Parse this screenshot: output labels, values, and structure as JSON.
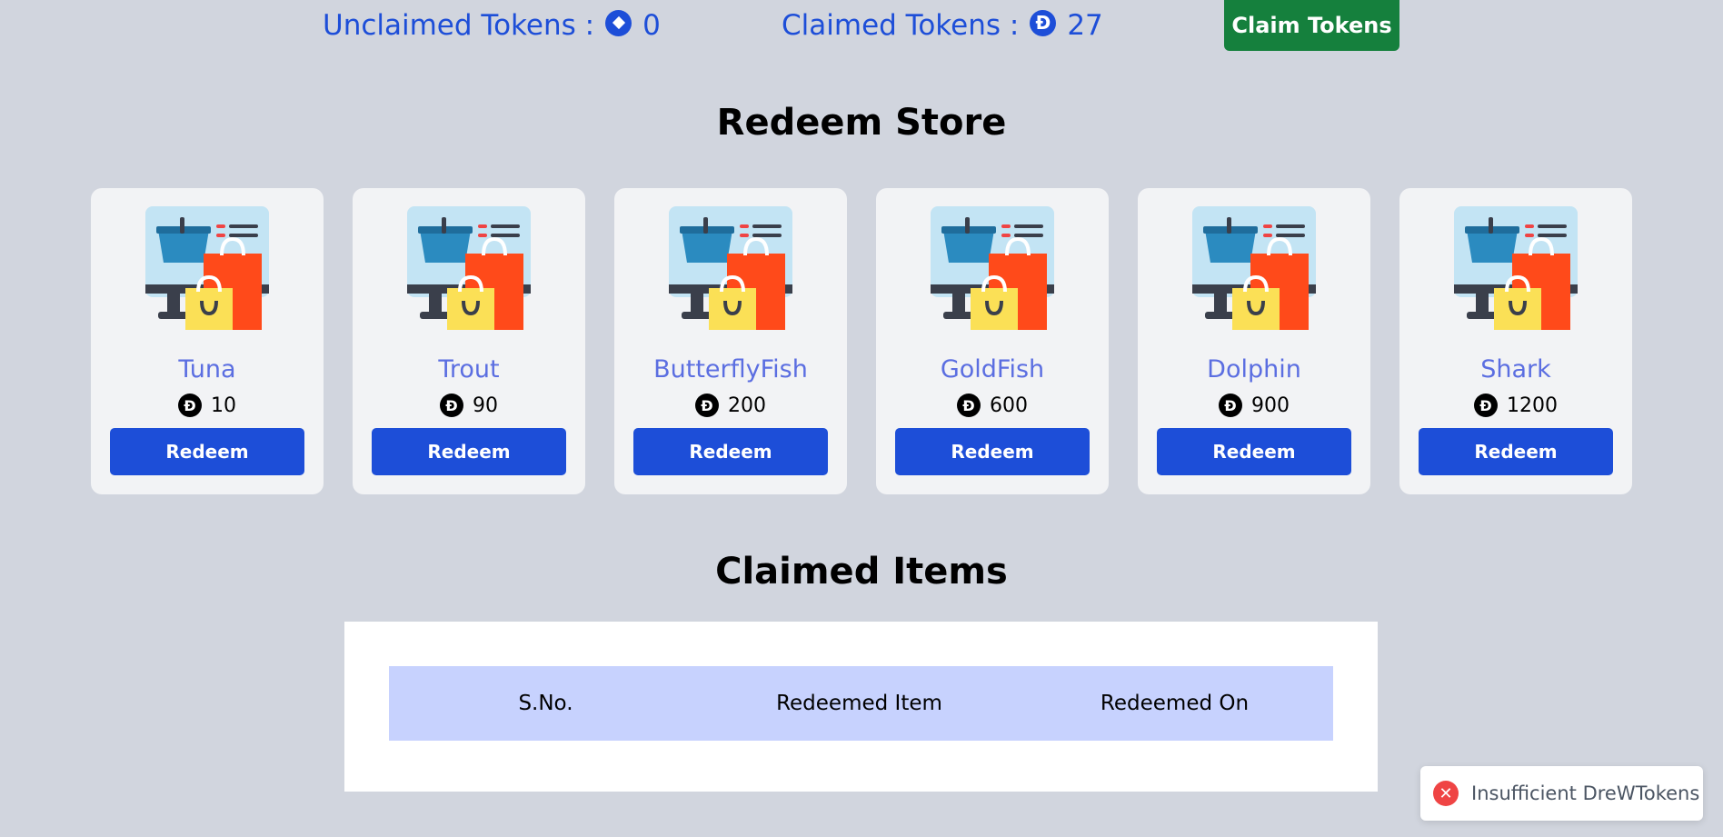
{
  "tokens": {
    "unclaimed_label": "Unclaimed Tokens :",
    "unclaimed_value": "0",
    "claimed_label": "Claimed Tokens :",
    "claimed_value": "27",
    "claimed_icon_glyph": "Đ",
    "claim_button_label": "Claim Tokens"
  },
  "store": {
    "title": "Redeem Store",
    "items": [
      {
        "name": "Tuna",
        "price": "10",
        "button": "Redeem"
      },
      {
        "name": "Trout",
        "price": "90",
        "button": "Redeem"
      },
      {
        "name": "ButterflyFish",
        "price": "200",
        "button": "Redeem"
      },
      {
        "name": "GoldFish",
        "price": "600",
        "button": "Redeem"
      },
      {
        "name": "Dolphin",
        "price": "900",
        "button": "Redeem"
      },
      {
        "name": "Shark",
        "price": "1200",
        "button": "Redeem"
      }
    ],
    "coin_glyph": "Đ"
  },
  "claimed": {
    "title": "Claimed Items",
    "columns": [
      "S.No.",
      "Redeemed Item",
      "Redeemed On"
    ]
  },
  "toast": {
    "message": "Insufficient DreWTokens",
    "icon_glyph": "✕"
  },
  "colors": {
    "background": "#d1d5de",
    "primary": "#1d4ed8",
    "claim_button": "#15803d",
    "item_name": "#5b6ee1",
    "table_header": "#c7d2fe",
    "error": "#ef4444"
  }
}
